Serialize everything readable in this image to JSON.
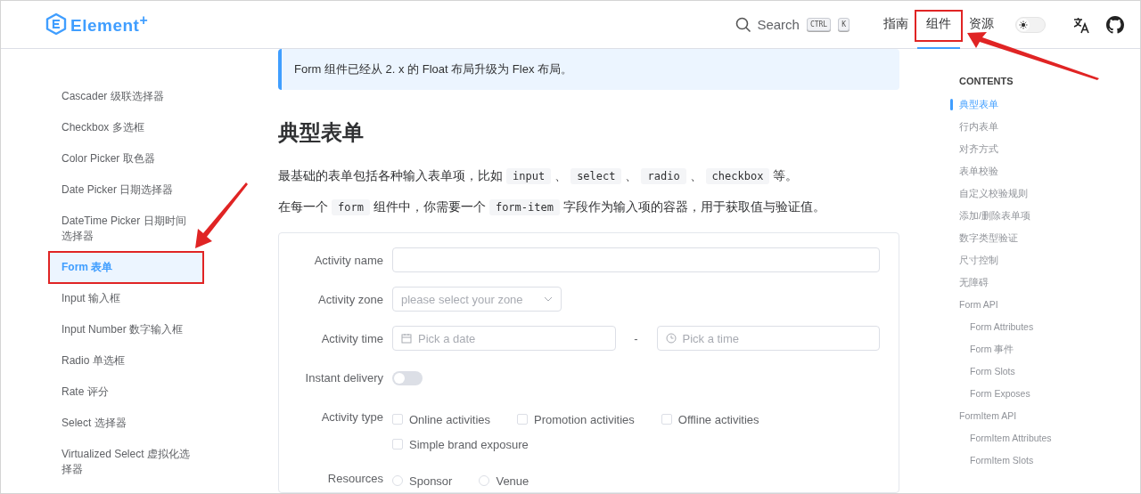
{
  "header": {
    "logo": "Element$^{+}$",
    "search": {
      "placeholder": "Search",
      "keys": [
        "CTRL",
        "K"
      ]
    },
    "nav": [
      {
        "label": "指南",
        "selected": false,
        "annotated": false
      },
      {
        "label": "组件",
        "selected": true,
        "annotated": true
      },
      {
        "label": "资源",
        "selected": false,
        "annotated": false
      }
    ],
    "dark_mode": false
  },
  "sidebar": {
    "items": [
      {
        "label": "Cascader 级联选择器",
        "selected": false,
        "annotated": false
      },
      {
        "label": "Checkbox 多选框",
        "selected": false,
        "annotated": false
      },
      {
        "label": "Color Picker 取色器",
        "selected": false,
        "annotated": false
      },
      {
        "label": "Date Picker 日期选择器",
        "selected": false,
        "annotated": false
      },
      {
        "label": "DateTime Picker 日期时间选择器",
        "selected": false,
        "annotated": false
      },
      {
        "label": "Form 表单",
        "selected": true,
        "annotated": true
      },
      {
        "label": "Input 输入框",
        "selected": false,
        "annotated": false
      },
      {
        "label": "Input Number 数字输入框",
        "selected": false,
        "annotated": false
      },
      {
        "label": "Radio 单选框",
        "selected": false,
        "annotated": false
      },
      {
        "label": "Rate 评分",
        "selected": false,
        "annotated": false
      },
      {
        "label": "Select 选择器",
        "selected": false,
        "annotated": false
      },
      {
        "label": "Virtualized Select 虚拟化选择器",
        "selected": false,
        "annotated": false
      }
    ]
  },
  "tip": "Form 组件已经从 2. x 的 Float 布局升级为 Flex 布局。",
  "heading": "典型表单",
  "paragraphs": [
    [
      {
        "kind": "text",
        "text": "最基础的表单包括各种输入表单项，比如"
      },
      {
        "kind": "code",
        "text": "input"
      },
      {
        "kind": "text",
        "text": "、"
      },
      {
        "kind": "code",
        "text": "select"
      },
      {
        "kind": "text",
        "text": "、"
      },
      {
        "kind": "code",
        "text": "radio"
      },
      {
        "kind": "text",
        "text": "、"
      },
      {
        "kind": "code",
        "text": "checkbox"
      },
      {
        "kind": "text",
        "text": "等。"
      }
    ],
    [
      {
        "kind": "text",
        "text": "在每一个"
      },
      {
        "kind": "code",
        "text": "form"
      },
      {
        "kind": "text",
        "text": "组件中，你需要一个"
      },
      {
        "kind": "code",
        "text": "form-item"
      },
      {
        "kind": "text",
        "text": "字段作为输入项的容器，用于获取值与验证值。"
      }
    ]
  ],
  "form": [
    {
      "kind": "input",
      "label": "Activity name"
    },
    {
      "kind": "select",
      "label": "Activity zone",
      "placeholder": "please select your zone"
    },
    {
      "kind": "datetime",
      "label": "Activity time",
      "date_placeholder": "Pick a date",
      "separator": "-",
      "time_placeholder": "Pick a time"
    },
    {
      "kind": "switch",
      "label": "Instant delivery",
      "on": false
    },
    {
      "kind": "checkboxes",
      "label": "Activity type",
      "options": [
        {
          "label": "Online activities",
          "checked": false
        },
        {
          "label": "Promotion activities",
          "checked": false
        },
        {
          "label": "Offline activities",
          "checked": false
        },
        {
          "label": "Simple brand exposure",
          "checked": false
        }
      ]
    },
    {
      "kind": "radios",
      "label": "Resources",
      "options": [
        {
          "label": "Sponsor",
          "selected": false
        },
        {
          "label": "Venue",
          "selected": false
        }
      ]
    }
  ],
  "toc": {
    "title": "CONTENTS",
    "items": [
      {
        "label": "典型表单",
        "selected": true
      },
      {
        "label": "行内表单",
        "selected": false
      },
      {
        "label": "对齐方式",
        "selected": false
      },
      {
        "label": "表单校验",
        "selected": false
      },
      {
        "label": "自定义校验规则",
        "selected": false
      },
      {
        "label": "添加/删除表单项",
        "selected": false
      },
      {
        "label": "数字类型验证",
        "selected": false
      },
      {
        "label": "尺寸控制",
        "selected": false
      },
      {
        "label": "无障碍",
        "selected": false
      },
      {
        "label": "Form API",
        "selected": false,
        "children": [
          {
            "label": "Form Attributes",
            "selected": false
          },
          {
            "label": "Form 事件",
            "selected": false
          },
          {
            "label": "Form Slots",
            "selected": false
          },
          {
            "label": "Form Exposes",
            "selected": false
          }
        ]
      },
      {
        "label": "FormItem API",
        "selected": false,
        "children": [
          {
            "label": "FormItem Attributes",
            "selected": false
          },
          {
            "label": "FormItem Slots",
            "selected": false
          }
        ]
      }
    ]
  }
}
